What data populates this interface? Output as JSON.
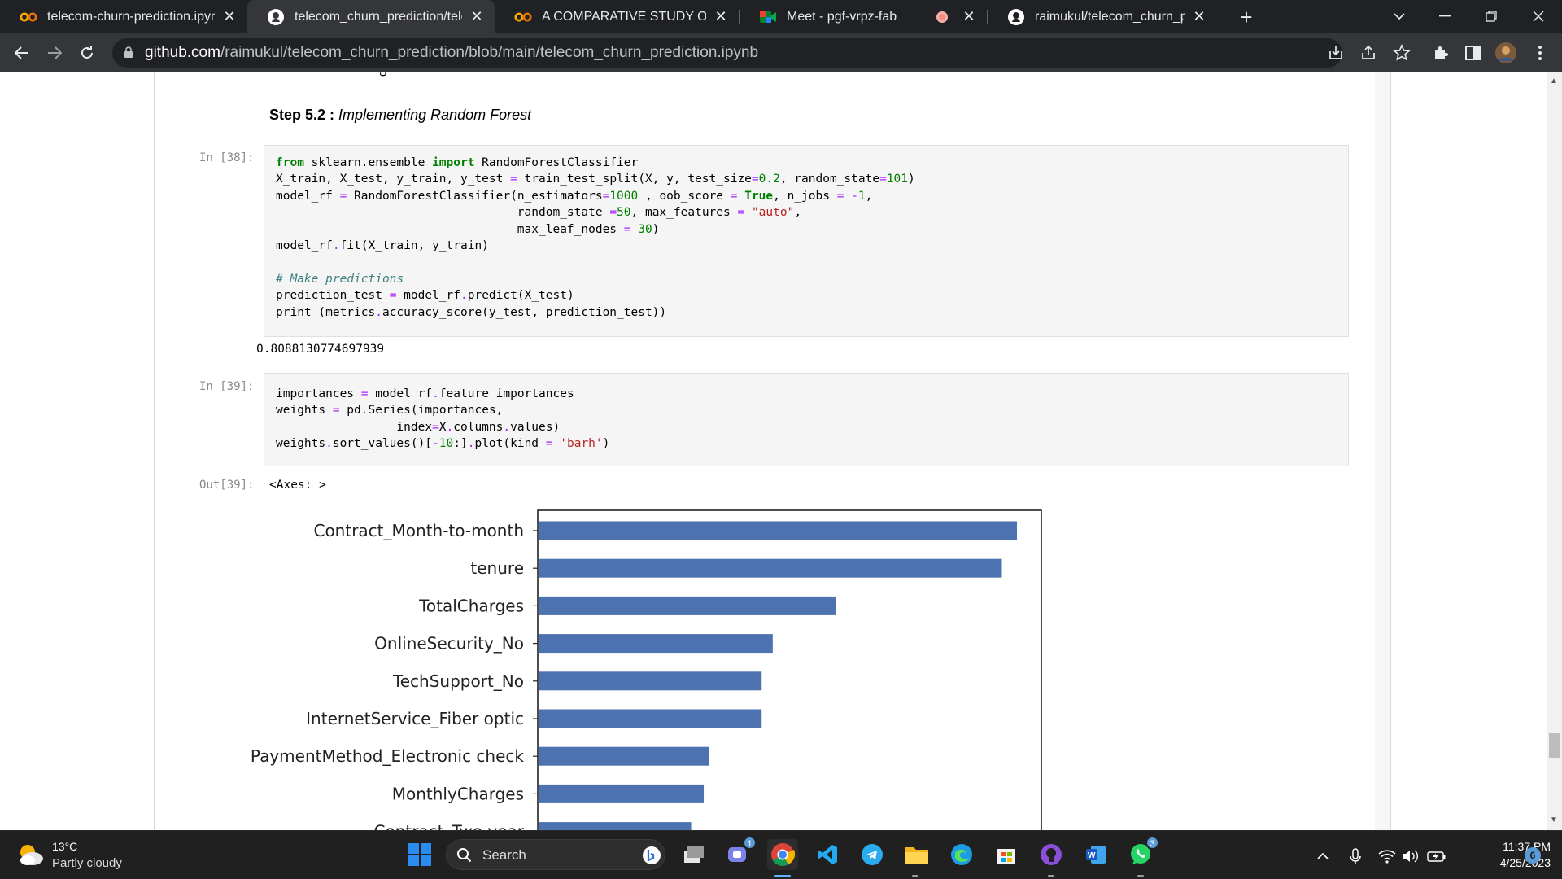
{
  "browser": {
    "tabs": [
      {
        "title": "telecom-churn-prediction.ipynb",
        "icon": "colab-icon",
        "active": false
      },
      {
        "title": "telecom_churn_prediction/teleco",
        "icon": "github-icon",
        "active": true
      },
      {
        "title": "A COMPARATIVE STUDY OF MUL",
        "icon": "colab-icon",
        "active": false
      },
      {
        "title": "Meet - pgf-vrpz-fab",
        "icon": "google-meet-icon",
        "active": false,
        "recording": true
      },
      {
        "title": "raimukul/telecom_churn_predicti",
        "icon": "github-icon",
        "active": false
      }
    ],
    "url_domain": "github.com",
    "url_path": "/raimukul/telecom_churn_prediction/blob/main/telecom_churn_prediction.ipynb"
  },
  "notebook": {
    "step_heading": {
      "bold": "Step 5.2 :",
      "italic": "Implementing Random Forest"
    },
    "cell38": {
      "prompt": "In [38]:",
      "lines": [
        [
          [
            "kw",
            "from"
          ],
          [
            "t",
            " sklearn.ensemble "
          ],
          [
            "kw",
            "import"
          ],
          [
            "t",
            " RandomForestClassifier"
          ]
        ],
        [
          [
            "t",
            "X_train, X_test, y_train, y_test "
          ],
          [
            "op",
            "="
          ],
          [
            "t",
            " train_test_split(X, y, test_size"
          ],
          [
            "op",
            "="
          ],
          [
            "nm",
            "0.2"
          ],
          [
            "t",
            ", random_state"
          ],
          [
            "op",
            "="
          ],
          [
            "nm",
            "101"
          ],
          [
            "t",
            ")"
          ]
        ],
        [
          [
            "t",
            "model_rf "
          ],
          [
            "op",
            "="
          ],
          [
            "t",
            " RandomForestClassifier(n_estimators"
          ],
          [
            "op",
            "="
          ],
          [
            "nm",
            "1000"
          ],
          [
            "t",
            " , oob_score "
          ],
          [
            "op",
            "="
          ],
          [
            "t",
            " "
          ],
          [
            "kw",
            "True"
          ],
          [
            "t",
            ", n_jobs "
          ],
          [
            "op",
            "="
          ],
          [
            "t",
            " "
          ],
          [
            "op",
            "-"
          ],
          [
            "nm",
            "1"
          ],
          [
            "t",
            ","
          ]
        ],
        [
          [
            "t",
            "                                  random_state "
          ],
          [
            "op",
            "="
          ],
          [
            "nm",
            "50"
          ],
          [
            "t",
            ", max_features "
          ],
          [
            "op",
            "="
          ],
          [
            "t",
            " "
          ],
          [
            "str",
            "\"auto\""
          ],
          [
            "t",
            ","
          ]
        ],
        [
          [
            "t",
            "                                  max_leaf_nodes "
          ],
          [
            "op",
            "="
          ],
          [
            "t",
            " "
          ],
          [
            "nm",
            "30"
          ],
          [
            "t",
            ")"
          ]
        ],
        [
          [
            "t",
            "model_rf"
          ],
          [
            "op",
            "."
          ],
          [
            "t",
            "fit(X_train, y_train)"
          ]
        ],
        [
          [
            "t",
            ""
          ]
        ],
        [
          [
            "cm",
            "# Make predictions"
          ]
        ],
        [
          [
            "t",
            "prediction_test "
          ],
          [
            "op",
            "="
          ],
          [
            "t",
            " model_rf"
          ],
          [
            "op",
            "."
          ],
          [
            "t",
            "predict(X_test)"
          ]
        ],
        [
          [
            "t",
            "print (metrics"
          ],
          [
            "op",
            "."
          ],
          [
            "t",
            "accuracy_score(y_test, prediction_test))"
          ]
        ]
      ],
      "output": "0.8088130774697939"
    },
    "cell39": {
      "prompt": "In [39]:",
      "lines": [
        [
          [
            "t",
            "importances "
          ],
          [
            "op",
            "="
          ],
          [
            "t",
            " model_rf"
          ],
          [
            "op",
            "."
          ],
          [
            "t",
            "feature_importances_"
          ]
        ],
        [
          [
            "t",
            "weights "
          ],
          [
            "op",
            "="
          ],
          [
            "t",
            " pd"
          ],
          [
            "op",
            "."
          ],
          [
            "t",
            "Series(importances,"
          ]
        ],
        [
          [
            "t",
            "                 index"
          ],
          [
            "op",
            "="
          ],
          [
            "t",
            "X"
          ],
          [
            "op",
            "."
          ],
          [
            "t",
            "columns"
          ],
          [
            "op",
            "."
          ],
          [
            "t",
            "values)"
          ]
        ],
        [
          [
            "t",
            "weights"
          ],
          [
            "op",
            "."
          ],
          [
            "t",
            "sort_values()["
          ],
          [
            "op",
            "-"
          ],
          [
            "nm",
            "10"
          ],
          [
            "t",
            ":]"
          ],
          [
            "op",
            "."
          ],
          [
            "t",
            "plot(kind "
          ],
          [
            "op",
            "="
          ],
          [
            "t",
            " "
          ],
          [
            "str",
            "'barh'"
          ],
          [
            "t",
            ")"
          ]
        ]
      ],
      "out_prompt": "Out[39]:",
      "output": "<Axes: >"
    }
  },
  "chart_data": {
    "type": "bar",
    "orientation": "horizontal",
    "categories": [
      "Contract_Month-to-month",
      "tenure",
      "TotalCharges",
      "OnlineSecurity_No",
      "TechSupport_No",
      "InternetService_Fiber optic",
      "PaymentMethod_Electronic check",
      "MonthlyCharges",
      "Contract_Two year"
    ],
    "values": [
      0.95,
      0.92,
      0.59,
      0.465,
      0.443,
      0.443,
      0.338,
      0.328,
      0.303
    ],
    "xlim": [
      0,
      1.0
    ],
    "bar_color": "#4c72b0",
    "grid": false
  },
  "taskbar": {
    "weather_temp": "13°C",
    "weather_desc": "Partly cloudy",
    "search_label": "Search",
    "teams_badge": "1",
    "whatsapp_badge": "3",
    "time": "11:37 PM",
    "date": "4/25/2023",
    "notification_count": "6"
  }
}
